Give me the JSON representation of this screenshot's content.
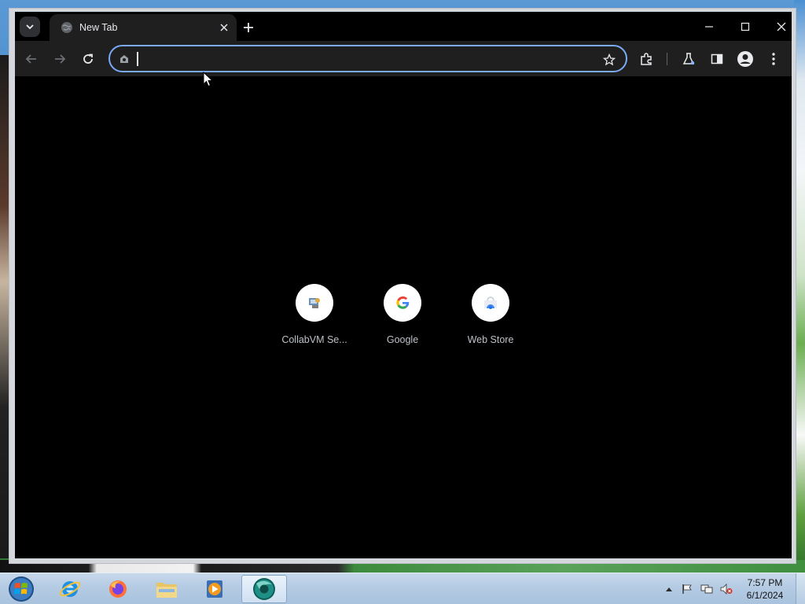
{
  "browser": {
    "tab": {
      "title": "New Tab"
    },
    "omnibox": {
      "value": "",
      "placeholder": ""
    },
    "theme": {
      "accent": "#7baaf7",
      "background": "#000000",
      "toolbar": "#1f1f1f"
    }
  },
  "shortcuts": [
    {
      "label": "CollabVM Se...",
      "icon": "collabvm-icon"
    },
    {
      "label": "Google",
      "icon": "google-icon"
    },
    {
      "label": "Web Store",
      "icon": "web-store-icon"
    }
  ],
  "taskbar": {
    "items": [
      "internet-explorer-icon",
      "firefox-icon",
      "file-explorer-icon",
      "media-player-icon",
      "chrome-icon"
    ],
    "clock": {
      "time": "7:57 PM",
      "date": "6/1/2024"
    }
  }
}
